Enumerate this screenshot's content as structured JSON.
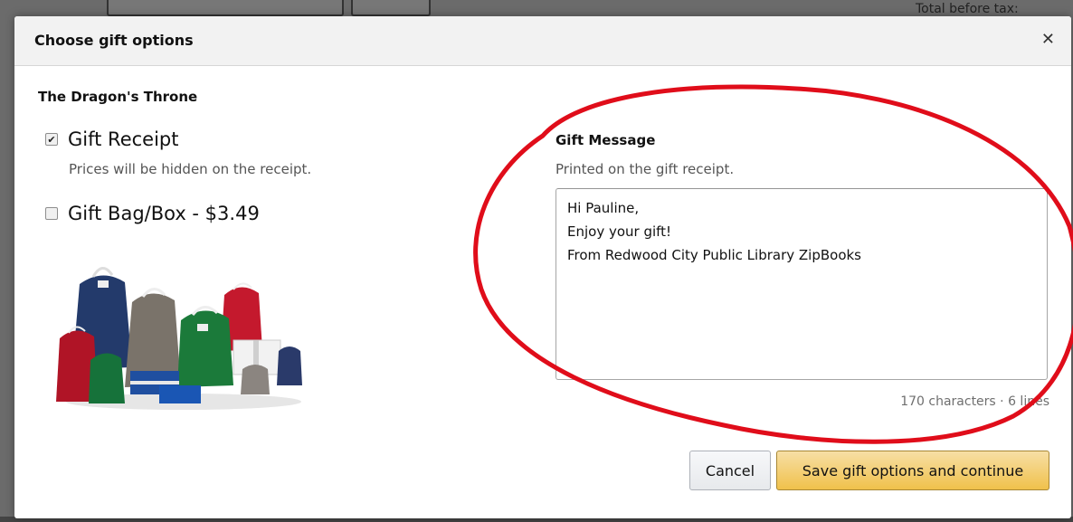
{
  "background": {
    "total_before_tax_label": "Total before tax:"
  },
  "dialog": {
    "title": "Choose gift options",
    "close_icon": "close-icon",
    "product_title": "The Dragon's Throne",
    "gift_receipt": {
      "label": "Gift Receipt",
      "checked": true,
      "description": "Prices will be hidden on the receipt."
    },
    "gift_bag": {
      "label": "Gift Bag/Box - $3.49",
      "checked": false
    },
    "gift_message": {
      "label": "Gift Message",
      "description": "Printed on the gift receipt.",
      "lines": [
        "Hi Pauline,",
        "Enjoy your gift!",
        "From Redwood City Public Library ZipBooks"
      ],
      "counter": "170 characters · 6 lines"
    },
    "buttons": {
      "cancel": "Cancel",
      "save": "Save gift options and continue"
    }
  },
  "colors": {
    "annotation_ellipse": "#e00d1a",
    "primary_button": "#f0c14b"
  }
}
